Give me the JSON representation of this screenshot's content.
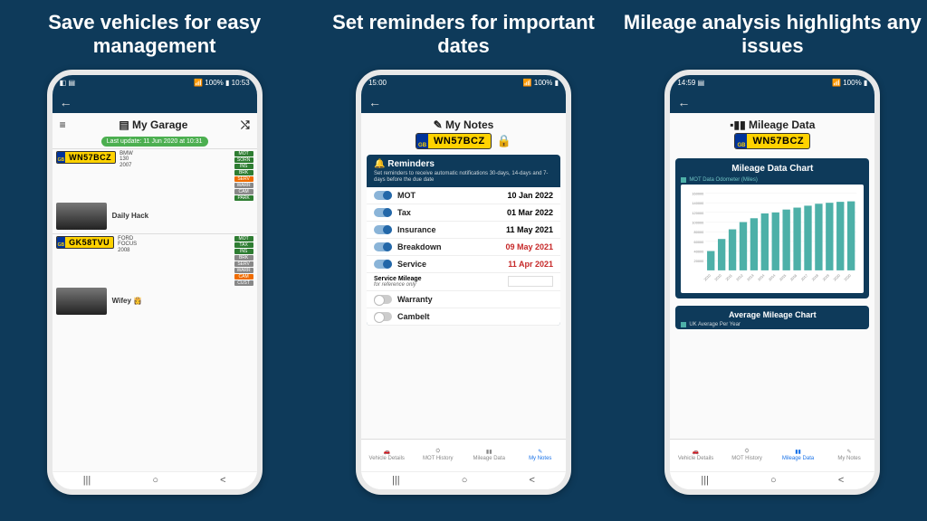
{
  "panels": [
    {
      "headline": "Save vehicles for easy management"
    },
    {
      "headline": "Set reminders for important dates"
    },
    {
      "headline": "Mileage analysis highlights any issues"
    }
  ],
  "status": {
    "time1": "10:53",
    "time2": "15:00",
    "time3": "14:59",
    "battery": "100%"
  },
  "garage": {
    "title": "My Garage",
    "last_update": "Last update: 11 Jun 2020 at 10:31",
    "vehicles": [
      {
        "reg": "WN57BCZ",
        "make": "BMW",
        "model": "130",
        "year": "2007",
        "nick": "Daily Hack",
        "badges": [
          {
            "t": "MOT",
            "c": "#2e7d32"
          },
          {
            "t": "SORN",
            "c": "#2e7d32"
          },
          {
            "t": "INS",
            "c": "#2e7d32"
          },
          {
            "t": "BRK",
            "c": "#2e7d32"
          },
          {
            "t": "SERV",
            "c": "#ef6c00"
          },
          {
            "t": "WARR",
            "c": "#888"
          },
          {
            "t": "CAM",
            "c": "#888"
          },
          {
            "t": "PARK",
            "c": "#2e7d32"
          }
        ]
      },
      {
        "reg": "GK58TVU",
        "make": "FORD",
        "model": "FOCUS",
        "year": "2008",
        "nick": "Wifey 👸",
        "badges": [
          {
            "t": "MOT",
            "c": "#2e7d32"
          },
          {
            "t": "TAX",
            "c": "#2e7d32"
          },
          {
            "t": "INS",
            "c": "#2e7d32"
          },
          {
            "t": "BRK",
            "c": "#888"
          },
          {
            "t": "SERV",
            "c": "#888"
          },
          {
            "t": "WARR",
            "c": "#888"
          },
          {
            "t": "CAM",
            "c": "#ef6c00"
          },
          {
            "t": "CUST",
            "c": "#888"
          }
        ]
      }
    ]
  },
  "notes": {
    "title": "My Notes",
    "plate": "WN57BCZ",
    "reminders_title": "Reminders",
    "reminders_desc": "Set reminders to receive automatic notifications 30-days, 14-days and 7-days before the due date",
    "reminders": [
      {
        "label": "MOT",
        "date": "10 Jan 2022",
        "on": true,
        "overdue": false
      },
      {
        "label": "Tax",
        "date": "01 Mar 2022",
        "on": true,
        "overdue": false
      },
      {
        "label": "Insurance",
        "date": "11 May 2021",
        "on": true,
        "overdue": false
      },
      {
        "label": "Breakdown",
        "date": "09 May 2021",
        "on": true,
        "overdue": true
      },
      {
        "label": "Service",
        "date": "11 Apr 2021",
        "on": true,
        "overdue": true
      }
    ],
    "service_mileage_label": "Service Mileage",
    "service_mileage_sub": "for reference only",
    "extra": [
      {
        "label": "Warranty",
        "on": false
      },
      {
        "label": "Cambelt",
        "on": false
      }
    ]
  },
  "mileage": {
    "title": "Mileage Data",
    "plate": "WN57BCZ",
    "chart_title": "Mileage Data Chart",
    "legend": "MOT Data Odometer (Miles)",
    "avg_title": "Average Mileage Chart",
    "avg_legend": "UK Average Per Year"
  },
  "tabs": [
    {
      "label": "Vehicle Details"
    },
    {
      "label": "MOT History"
    },
    {
      "label": "Mileage Data"
    },
    {
      "label": "My Notes"
    }
  ],
  "chart_data": {
    "type": "bar",
    "title": "Mileage Data Chart",
    "xlabel": "",
    "ylabel": "MOT Data Odometer (Miles)",
    "ylim": [
      0,
      160000
    ],
    "categories": [
      "2010",
      "2010",
      "2011",
      "2012",
      "2013",
      "2014",
      "2014",
      "2015",
      "2016",
      "2017",
      "2018",
      "2019",
      "2020",
      "2020"
    ],
    "values": [
      40000,
      65000,
      85000,
      100000,
      108000,
      118000,
      120000,
      126000,
      130000,
      134000,
      138000,
      140000,
      142000,
      143000
    ],
    "y_ticks": [
      20000,
      40000,
      60000,
      80000,
      100000,
      120000,
      140000,
      160000
    ]
  }
}
